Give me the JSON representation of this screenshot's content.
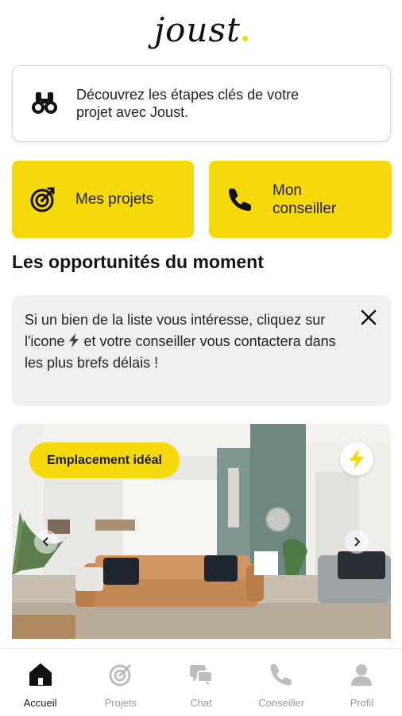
{
  "header": {
    "logo_text": "joust"
  },
  "discover": {
    "text": "Découvrez les étapes clés de votre projet avec Joust.",
    "icon": "binoculars-icon"
  },
  "quick_actions": [
    {
      "label": "Mes projets",
      "icon": "target-icon"
    },
    {
      "label": "Mon conseiller",
      "icon": "phone-icon"
    }
  ],
  "section": {
    "title": "Les opportunités du moment"
  },
  "info": {
    "text_before": "Si un bien de la liste vous intéresse, cliquez sur l'icone",
    "text_after": "et votre conseiller vous contactera dans les plus brefs délais !",
    "close_icon": "close-icon"
  },
  "listing": {
    "badge": "Emplacement idéal",
    "flash_icon": "lightning-icon"
  },
  "nav": {
    "items": [
      {
        "label": "Accueil",
        "icon": "home-icon",
        "active": true
      },
      {
        "label": "Projets",
        "icon": "target-icon",
        "active": false
      },
      {
        "label": "Chat",
        "icon": "chat-icon",
        "active": false
      },
      {
        "label": "Conseiller",
        "icon": "phone-icon",
        "active": false
      },
      {
        "label": "Profil",
        "icon": "user-icon",
        "active": false
      }
    ]
  },
  "colors": {
    "accent": "#f5d90a",
    "text": "#1a1a1a",
    "muted": "#9a9a9a",
    "panel": "#f0f0f0"
  }
}
